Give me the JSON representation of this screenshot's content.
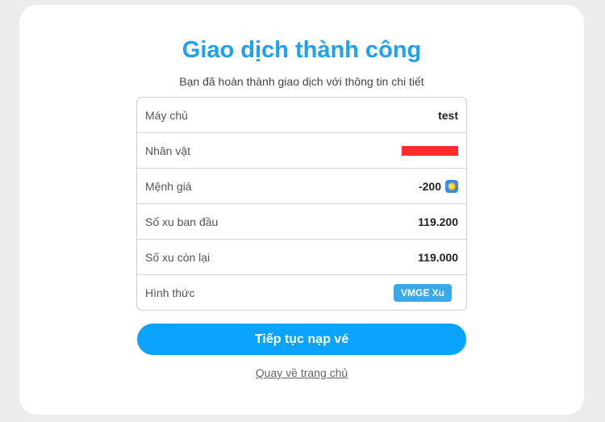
{
  "header": {
    "title": "Giao dịch thành công",
    "subtitle": "Bạn đã hoàn thành giao dịch với thông tin chi tiết"
  },
  "details": {
    "server": {
      "label": "Máy chủ",
      "value": "test"
    },
    "character": {
      "label": "Nhân vật",
      "value_redacted": true
    },
    "denomination": {
      "label": "Mệnh giá",
      "value": "-200",
      "icon": "coin-icon"
    },
    "initial_balance": {
      "label": "Số xu ban đầu",
      "value": "119.200"
    },
    "remaining_balance": {
      "label": "Số xu còn lại",
      "value": "119.000"
    },
    "method": {
      "label": "Hình thức",
      "value": "VMGE Xu"
    }
  },
  "actions": {
    "continue_label": "Tiếp tục nạp vé",
    "home_label": "Quay về trang chủ"
  },
  "colors": {
    "accent": "#1da1f2",
    "button": "#0aa3ff",
    "badge": "#3aa9ea",
    "redaction": "#ff2a2a",
    "background": "#ececec"
  }
}
